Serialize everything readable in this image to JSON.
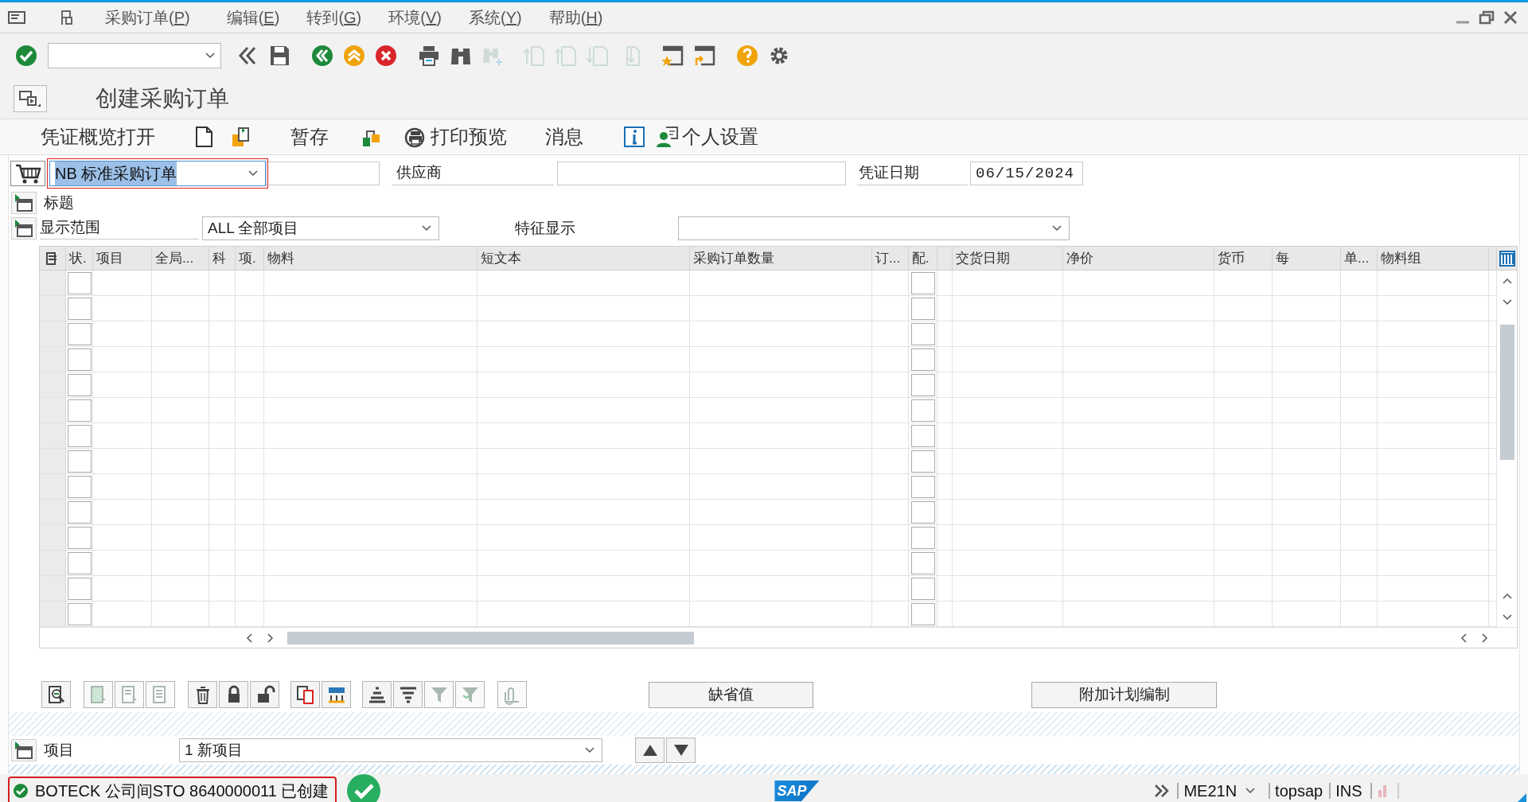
{
  "menu_bar": {
    "items": [
      {
        "label": "采购订单(P)"
      },
      {
        "label": "编辑(E)"
      },
      {
        "label": "转到(G)"
      },
      {
        "label": "环境(V)"
      },
      {
        "label": "系统(Y)"
      },
      {
        "label": "帮助(H)"
      }
    ]
  },
  "toolbar": {
    "buttons": [
      {
        "kind": "enter",
        "disabled": false
      },
      {
        "kind": "back_double",
        "disabled": false
      },
      {
        "kind": "save",
        "disabled": false
      },
      {
        "kind": "back",
        "disabled": false
      },
      {
        "kind": "exit",
        "disabled": false
      },
      {
        "kind": "cancel",
        "disabled": false
      },
      {
        "kind": "print",
        "disabled": false
      },
      {
        "kind": "find",
        "disabled": false
      },
      {
        "kind": "find_next",
        "disabled": true
      },
      {
        "kind": "first_page",
        "disabled": true
      },
      {
        "kind": "prev_page",
        "disabled": true
      },
      {
        "kind": "next_page",
        "disabled": true
      },
      {
        "kind": "last_page",
        "disabled": true
      },
      {
        "kind": "new_session",
        "disabled": false
      },
      {
        "kind": "shortcut",
        "disabled": false
      },
      {
        "kind": "help",
        "disabled": false
      },
      {
        "kind": "settings",
        "disabled": false
      }
    ]
  },
  "title": "创建采购订单",
  "app_toolbar": {
    "items": [
      {
        "kind": "text",
        "label": "凭证概览打开"
      },
      {
        "kind": "new_doc"
      },
      {
        "kind": "transfer"
      },
      {
        "kind": "text",
        "label": "暂存"
      },
      {
        "kind": "check"
      },
      {
        "kind": "preview",
        "label": "打印预览"
      },
      {
        "kind": "text",
        "label": "消息"
      },
      {
        "kind": "info"
      },
      {
        "kind": "personal",
        "label": "个人设置"
      }
    ]
  },
  "header": {
    "order_type": {
      "value": "NB 标准采购订单",
      "selected": true
    },
    "supplier": {
      "label": "供应商"
    },
    "doc_date": {
      "label": "凭证日期",
      "value": "06/15/2024"
    }
  },
  "header_section": {
    "label": "标题",
    "expanded": false
  },
  "display": {
    "label": "显示范围",
    "value": "ALL 全部项目",
    "feature_label": "特征显示"
  },
  "table": {
    "columns": [
      {
        "label": "状.",
        "kind": "check"
      },
      {
        "label": "项目",
        "kind": "text"
      },
      {
        "label": "全局...",
        "kind": "text"
      },
      {
        "label": "科",
        "kind": "text"
      },
      {
        "label": "项.",
        "kind": "text"
      },
      {
        "label": "物料",
        "kind": "text"
      },
      {
        "label": "短文本",
        "kind": "text"
      },
      {
        "label": "采购订单数量",
        "kind": "text"
      },
      {
        "label": "订...",
        "kind": "text"
      },
      {
        "label": "配.",
        "kind": "check"
      },
      {
        "kind": "text"
      },
      {
        "label": "交货日期",
        "kind": "text"
      },
      {
        "label": "净价",
        "kind": "text"
      },
      {
        "label": "货币",
        "kind": "text"
      },
      {
        "label": "每",
        "kind": "text"
      },
      {
        "label": "单...",
        "kind": "text"
      },
      {
        "label": "物料组",
        "kind": "text"
      }
    ],
    "rows": [
      {
        "selected": false,
        "checks": [
          false,
          false
        ]
      },
      {
        "selected": false,
        "checks": [
          false,
          false
        ]
      },
      {
        "selected": false,
        "checks": [
          false,
          false
        ]
      },
      {
        "selected": false,
        "checks": [
          false,
          false
        ]
      },
      {
        "selected": false,
        "checks": [
          false,
          false
        ]
      },
      {
        "selected": false,
        "checks": [
          false,
          false
        ]
      },
      {
        "selected": false,
        "checks": [
          false,
          false
        ]
      },
      {
        "selected": false,
        "checks": [
          false,
          false
        ]
      },
      {
        "selected": false,
        "checks": [
          false,
          false
        ]
      },
      {
        "selected": false,
        "checks": [
          false,
          false
        ]
      },
      {
        "selected": false,
        "checks": [
          false,
          false
        ]
      },
      {
        "selected": false,
        "checks": [
          false,
          false
        ]
      },
      {
        "selected": false,
        "checks": [
          false,
          false
        ]
      },
      {
        "selected": false,
        "checks": [
          false,
          false
        ]
      }
    ]
  },
  "table_toolbar": {
    "buttons": [
      {
        "kind": "details",
        "disabled": false
      },
      {
        "kind": "select_all",
        "disabled": true
      },
      {
        "kind": "deselect",
        "disabled": true
      },
      {
        "kind": "select_block",
        "disabled": true
      },
      {
        "kind": "delete",
        "disabled": false
      },
      {
        "kind": "lock",
        "disabled": false
      },
      {
        "kind": "unlock",
        "disabled": false
      },
      {
        "kind": "copy",
        "disabled": false
      },
      {
        "kind": "distribute",
        "disabled": false
      },
      {
        "kind": "sort_asc",
        "disabled": false
      },
      {
        "kind": "sort_desc",
        "disabled": false
      },
      {
        "kind": "filter",
        "disabled": true
      },
      {
        "kind": "filter_delete",
        "disabled": true
      },
      {
        "kind": "attach",
        "disabled": true
      }
    ],
    "text_buttons": [
      {
        "label": "缺省值"
      },
      {
        "label": "附加计划编制"
      }
    ]
  },
  "item_row": {
    "label": "项目",
    "value": "1 新项目"
  },
  "status_bar": {
    "message": "BOTECK 公司间STO 8640000011 已创建",
    "logo": "SAP",
    "transaction": "ME21N",
    "system": "topsap",
    "mode": "INS"
  }
}
